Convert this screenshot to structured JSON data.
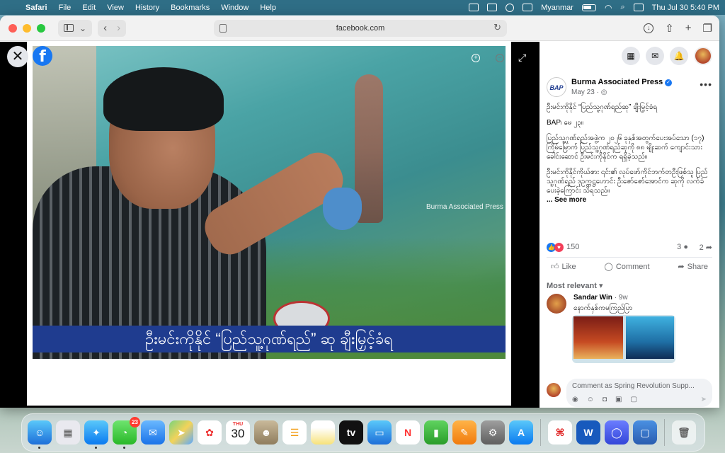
{
  "menubar": {
    "app": "Safari",
    "items": [
      "File",
      "Edit",
      "View",
      "History",
      "Bookmarks",
      "Window",
      "Help"
    ],
    "input_source": "Myanmar",
    "datetime": "Thu Jul 30  5:40 PM"
  },
  "browser": {
    "url": "facebook.com"
  },
  "viewer": {
    "watermark": "Burma Associated Press",
    "caption": "ဦးမင်းကိုနိုင် “ပြည်သူ့ဂုဏ်ရည်” ဆု ချီးမြှင့်ခံရ"
  },
  "post": {
    "page_name": "Burma Associated Press",
    "logo_text": "BAP",
    "date": "May 23 · ",
    "headline": "ဦးမင်းကိုနိုင် “ပြည်သူ့ဂုဏ်ရည်ဆု” ချီးမြှင့်ခံရ",
    "dateline": "BAP၊ မေ ၂၃။",
    "para1": "ပြည်သူ့ဂုဏ်ရည်အဖွဲ့က ၂၀၂၆ ခုနှစ်အတွက်ပေးအပ်သော (၁၇) ကြိမ်မြောက် ပြည်သူ့ဂုဏ်ရည်ဆုကို ၈၈ မျိုးဆက် ကျောင်းသား ခေါင်းဆောင် ဦးမင်းကိုနိုင်က ရရှိခဲ့သည်။",
    "para2": "ဦးမင်းကိုနိုင်ကိုယ်စား ၎င်း၏ လုပ်ဖော်ကိုင်ဘက်တဦးဖြစ်သူ ပြည်သူ့ဂုဏ်ရည် ဒုဥက္ကဋ္ဌဟောင်း ဦးဇော်ဇော်အောင်က ဆုကို လက်ခံပေးခဲ့ကြောင်း သိရသည်။",
    "see_more": "... See more",
    "reaction_count": "150",
    "comment_count": "3",
    "share_count": "2",
    "like_label": "Like",
    "comment_label": "Comment",
    "share_label": "Share",
    "sort_label": "Most relevant"
  },
  "comment": {
    "author": "Sandar Win",
    "time": " · 9w",
    "text": "နောက်နှစ်ကမကြည်ပြာ"
  },
  "comment_box": {
    "placeholder": "Comment as Spring Revolution Supp..."
  },
  "dock": {
    "messages_badge": "23",
    "calendar_month": "THU",
    "calendar_day": "30"
  }
}
